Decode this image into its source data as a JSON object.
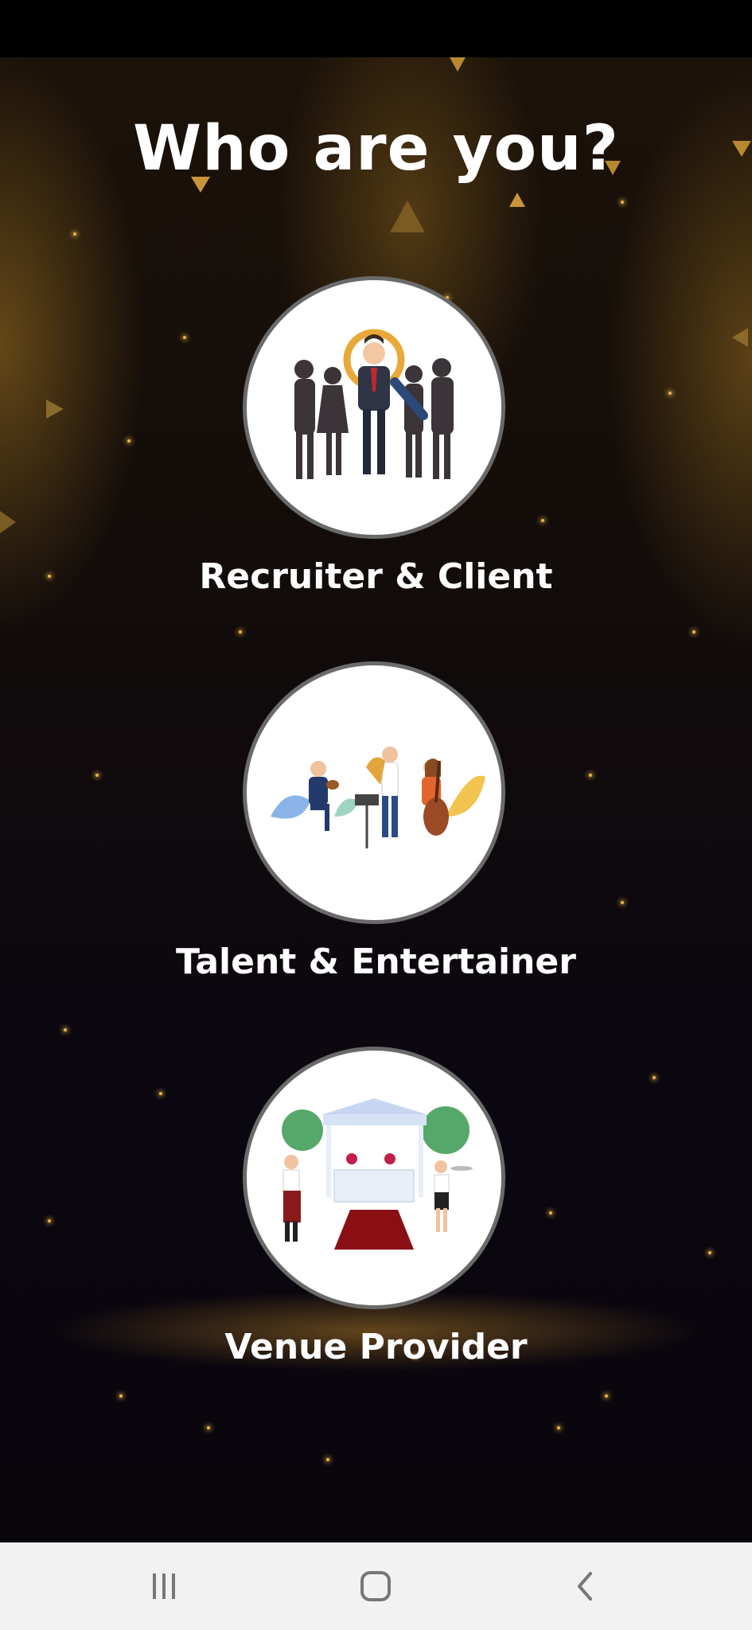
{
  "screen": {
    "title": "Who are you?",
    "accent_color": "#e7b44b",
    "background_color": "#0b0710"
  },
  "roles": [
    {
      "label": "Recruiter & Client",
      "illustration": "recruiter-magnifier-illustration"
    },
    {
      "label": "Talent & Entertainer",
      "illustration": "musicians-band-illustration"
    },
    {
      "label": "Venue Provider",
      "illustration": "venue-tent-waiters-illustration"
    }
  ],
  "navigation": {
    "recents_icon": "recents-icon",
    "home_icon": "home-icon",
    "back_icon": "back-icon"
  }
}
